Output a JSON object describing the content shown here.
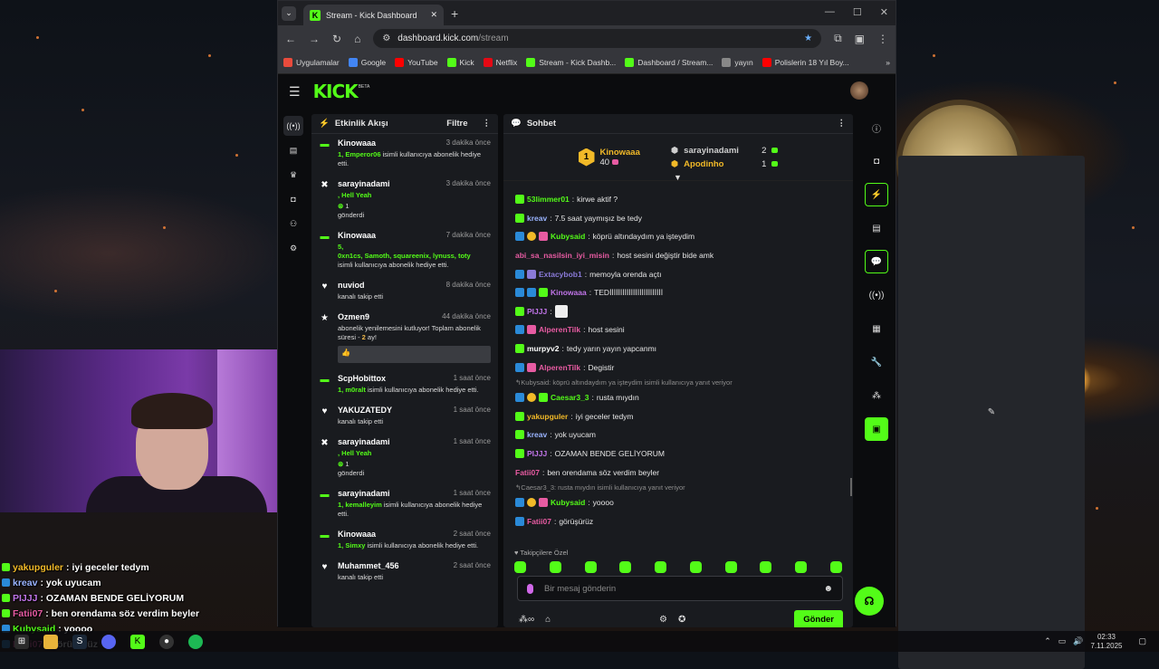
{
  "browser": {
    "tab_title": "Stream - Kick Dashboard",
    "url_host": "dashboard.kick.com",
    "url_path": "/stream",
    "bookmarks": [
      {
        "label": "Uygulamalar",
        "color": "#e94b3c"
      },
      {
        "label": "Google",
        "color": "#4285f4"
      },
      {
        "label": "YouTube",
        "color": "#ff0000"
      },
      {
        "label": "Kick",
        "color": "#53fc18"
      },
      {
        "label": "Netflix",
        "color": "#e50914"
      },
      {
        "label": "Stream - Kick Dashb...",
        "color": "#53fc18"
      },
      {
        "label": "Dashboard / Stream...",
        "color": "#53fc18"
      },
      {
        "label": "yayın",
        "color": "#888888"
      },
      {
        "label": "Polislerin 18 Yıl Boy...",
        "color": "#ff0000"
      }
    ]
  },
  "app": {
    "logo": "KICK",
    "logo_badge": "BETA"
  },
  "activity": {
    "title": "Etkinlik Akışı",
    "filter": "Filtre",
    "events": [
      {
        "icon": "gift",
        "name": "Kinowaaa",
        "time": "3 dakika önce",
        "parts": [
          {
            "t": "1, Emperor06",
            "c": "g"
          },
          {
            "t": " isimli kullanıcıya abonelik hediye etti.",
            "c": ""
          }
        ]
      },
      {
        "icon": "kick",
        "name": "sarayinadami",
        "time": "3 dakika önce",
        "parts": [
          {
            "t": ", Hell Yeah",
            "c": "g"
          }
        ],
        "extra": "1",
        "extra2": "gönderdi"
      },
      {
        "icon": "gift",
        "name": "Kinowaaa",
        "time": "7 dakika önce",
        "parts": [
          {
            "t": "5,",
            "c": "g"
          }
        ],
        "list": "0xn1cs, Samoth, squareenix, lynuss, toty",
        "tail": "isimli kullanıcıya abonelik hediye etti."
      },
      {
        "icon": "heart",
        "name": "nuviod",
        "time": "8 dakika önce",
        "parts": [
          {
            "t": "kanalı takip etti",
            "c": ""
          }
        ]
      },
      {
        "icon": "star",
        "name": "Ozmen9",
        "time": "44 dakika önce",
        "parts": [
          {
            "t": "abonelik yenilemesini kutluyor! Toplam abonelik süresi - ",
            "c": ""
          },
          {
            "t": "2",
            "c": "y"
          },
          {
            "t": " ay!",
            "c": ""
          }
        ],
        "box": "👍"
      },
      {
        "icon": "gift",
        "name": "ScpHobittox",
        "time": "1 saat önce",
        "parts": [
          {
            "t": "1, m0ralt",
            "c": "g"
          },
          {
            "t": " isimli kullanıcıya abonelik hediye etti.",
            "c": ""
          }
        ]
      },
      {
        "icon": "heart",
        "name": "YAKUZATEDY",
        "time": "1 saat önce",
        "parts": [
          {
            "t": "kanalı takip etti",
            "c": ""
          }
        ]
      },
      {
        "icon": "kick",
        "name": "sarayinadami",
        "time": "1 saat önce",
        "parts": [
          {
            "t": ", Hell Yeah",
            "c": "g"
          }
        ],
        "extra": "1",
        "extra2": "gönderdi"
      },
      {
        "icon": "gift",
        "name": "sarayinadami",
        "time": "1 saat önce",
        "parts": [
          {
            "t": "1, kemalleyim",
            "c": "g"
          },
          {
            "t": " isimli kullanıcıya abonelik hediye etti.",
            "c": ""
          }
        ]
      },
      {
        "icon": "gift",
        "name": "Kinowaaa",
        "time": "2 saat önce",
        "parts": [
          {
            "t": "1, Simxy",
            "c": "g"
          },
          {
            "t": " isimli kullanıcıya abonelik hediye etti.",
            "c": ""
          }
        ]
      },
      {
        "icon": "heart",
        "name": "Muhammet_456",
        "time": "2 saat önce",
        "parts": [
          {
            "t": "kanalı takip etti",
            "c": ""
          }
        ]
      }
    ]
  },
  "chat": {
    "title": "Sohbet",
    "pinned": {
      "rank": "1",
      "top_name": "Kinowaaa",
      "top_count": "40",
      "second": [
        {
          "name": "sarayinadami",
          "count": "2",
          "color": "#cfcfcf"
        },
        {
          "name": "Apodinho",
          "count": "1",
          "color": "#f1b928"
        }
      ]
    },
    "messages": [
      {
        "badges": [
          "g"
        ],
        "user": "53limmer01",
        "color": "#53fc18",
        "text": "kirwe aktif ?"
      },
      {
        "badges": [
          "g"
        ],
        "user": "kreav",
        "color": "#9ab4ff",
        "text": "7.5 saat yaymışız be tedy"
      },
      {
        "badges": [
          "b",
          "o",
          "p"
        ],
        "user": "Kubysaid",
        "color": "#53fc18",
        "text": "köprü altındaydım ya işteydim"
      },
      {
        "badges": [],
        "user": "abi_sa_nasilsin_iyi_misin",
        "color": "#e75ba2",
        "text": "host sesini değiştir bide amk"
      },
      {
        "badges": [
          "b",
          "v"
        ],
        "user": "Extacybob1",
        "color": "#8a7ad8",
        "text": "memoyla orenda açtı"
      },
      {
        "badges": [
          "b",
          "b",
          "g"
        ],
        "user": "Kinowaaa",
        "color": "#c074e8",
        "text": "TEDİİİİİİİİİİİİİİİİİİİİİİİİİ"
      },
      {
        "badges": [
          "g"
        ],
        "user": "PIJJJ",
        "color": "#c074e8",
        "text": ""
      },
      {
        "badges": [
          "b",
          "p"
        ],
        "user": "AlperenTilk",
        "color": "#e75ba2",
        "text": "host sesini"
      },
      {
        "badges": [
          "g"
        ],
        "user": "murpyv2",
        "color": "#ffffff",
        "text": "tedy yarın yayın yapcanmı"
      },
      {
        "badges": [
          "b",
          "p"
        ],
        "user": "AlperenTilk",
        "color": "#e75ba2",
        "text": "Degistir"
      },
      {
        "reply": "Kubysaid: köprü altındaydım ya işteydim isimli kullanıcıya yanıt veriyor"
      },
      {
        "badges": [
          "b",
          "o",
          "g"
        ],
        "user": "Caesar3_3",
        "color": "#53fc18",
        "text": "rusta mıydın"
      },
      {
        "badges": [
          "g"
        ],
        "user": "yakupguler",
        "color": "#f1b928",
        "text": "iyi geceler tedym"
      },
      {
        "badges": [
          "g"
        ],
        "user": "kreav",
        "color": "#9ab4ff",
        "text": "yok uyucam"
      },
      {
        "badges": [
          "g"
        ],
        "user": "PIJJJ",
        "color": "#c074e8",
        "text": "OZAMAN BENDE GELİYORUM"
      },
      {
        "badges": [],
        "user": "Fatii07",
        "color": "#e75ba2",
        "text": "ben orendama söz verdim beyler"
      },
      {
        "reply": "Caesar3_3: rusta mıydın isimli kullanıcıya yanıt veriyor"
      },
      {
        "badges": [
          "b",
          "o",
          "p"
        ],
        "user": "Kubysaid",
        "color": "#53fc18",
        "text": "yoooo"
      },
      {
        "badges": [
          "b"
        ],
        "user": "Fatii07",
        "color": "#e75ba2",
        "text": "görüşürüz"
      }
    ],
    "followers_only": "Takipçilere Özel",
    "input_placeholder": "Bir mesaj gönderin",
    "send_label": "Gönder"
  },
  "overlay_chat": [
    {
      "badge": "g",
      "user": "yakupguler",
      "color": "#f1b928",
      "text": " : iyi geceler tedym"
    },
    {
      "badge": "b",
      "user": "kreav",
      "color": "#9ab4ff",
      "text": " : yok uyucam"
    },
    {
      "badge": "g",
      "user": "PIJJJ",
      "color": "#c074e8",
      "text": " : OZAMAN BENDE GELİYORUM"
    },
    {
      "badge": "g",
      "user": "Fatii07",
      "color": "#e75ba2",
      "text": " : ben orendama söz verdim beyler"
    },
    {
      "badge": "b",
      "user": "Kubysaid",
      "color": "#53fc18",
      "text": " : yoooo"
    },
    {
      "badge": "b",
      "user": "Fatii07",
      "color": "#e75ba2",
      "text": " : görüşürüz"
    }
  ],
  "taskbar": {
    "time": "02:33",
    "date": "7.11.2025"
  },
  "colors": {
    "accent": "#53fc18"
  }
}
